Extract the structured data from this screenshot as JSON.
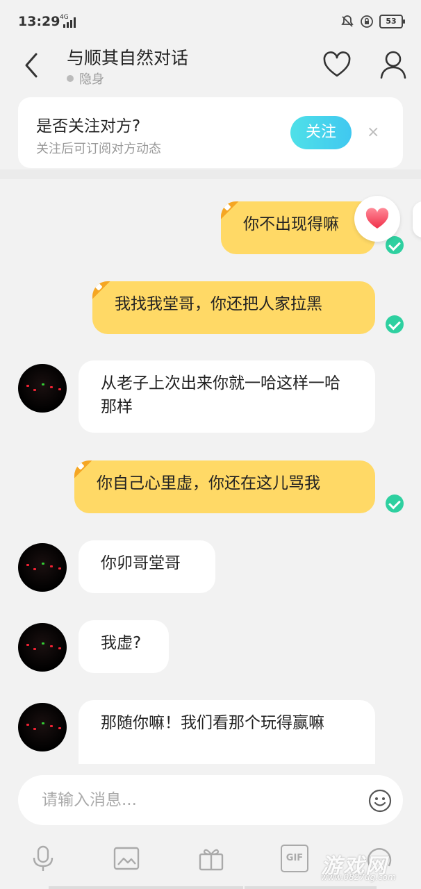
{
  "status_bar": {
    "time": "13:29",
    "network": "4G",
    "battery": "53"
  },
  "header": {
    "title": "与顺其自然对话",
    "presence": "隐身"
  },
  "follow_prompt": {
    "question": "是否关注对方?",
    "subtitle": "关注后可订阅对方动态",
    "follow_label": "关注",
    "close_label": "×"
  },
  "messages": [
    {
      "direction": "out",
      "text": "你不出现得嘛",
      "delivered": true
    },
    {
      "direction": "out",
      "text": "我找我堂哥，你还把人家拉黑",
      "delivered": true
    },
    {
      "direction": "in",
      "text": "从老子上次出来你就一哈这样一哈那样"
    },
    {
      "direction": "out",
      "text": "你自己心里虚，你还在这儿骂我",
      "delivered": true
    },
    {
      "direction": "in",
      "text": "你卯哥堂哥"
    },
    {
      "direction": "in",
      "text": "我虚?"
    },
    {
      "direction": "in",
      "text": "那随你嘛！我们看那个玩得赢嘛"
    }
  ],
  "input": {
    "placeholder": "请输入消息..."
  },
  "toolbar": {
    "gif_label": "GIF"
  },
  "watermark": {
    "text": "游戏网",
    "url": "www.0827ug.com"
  }
}
